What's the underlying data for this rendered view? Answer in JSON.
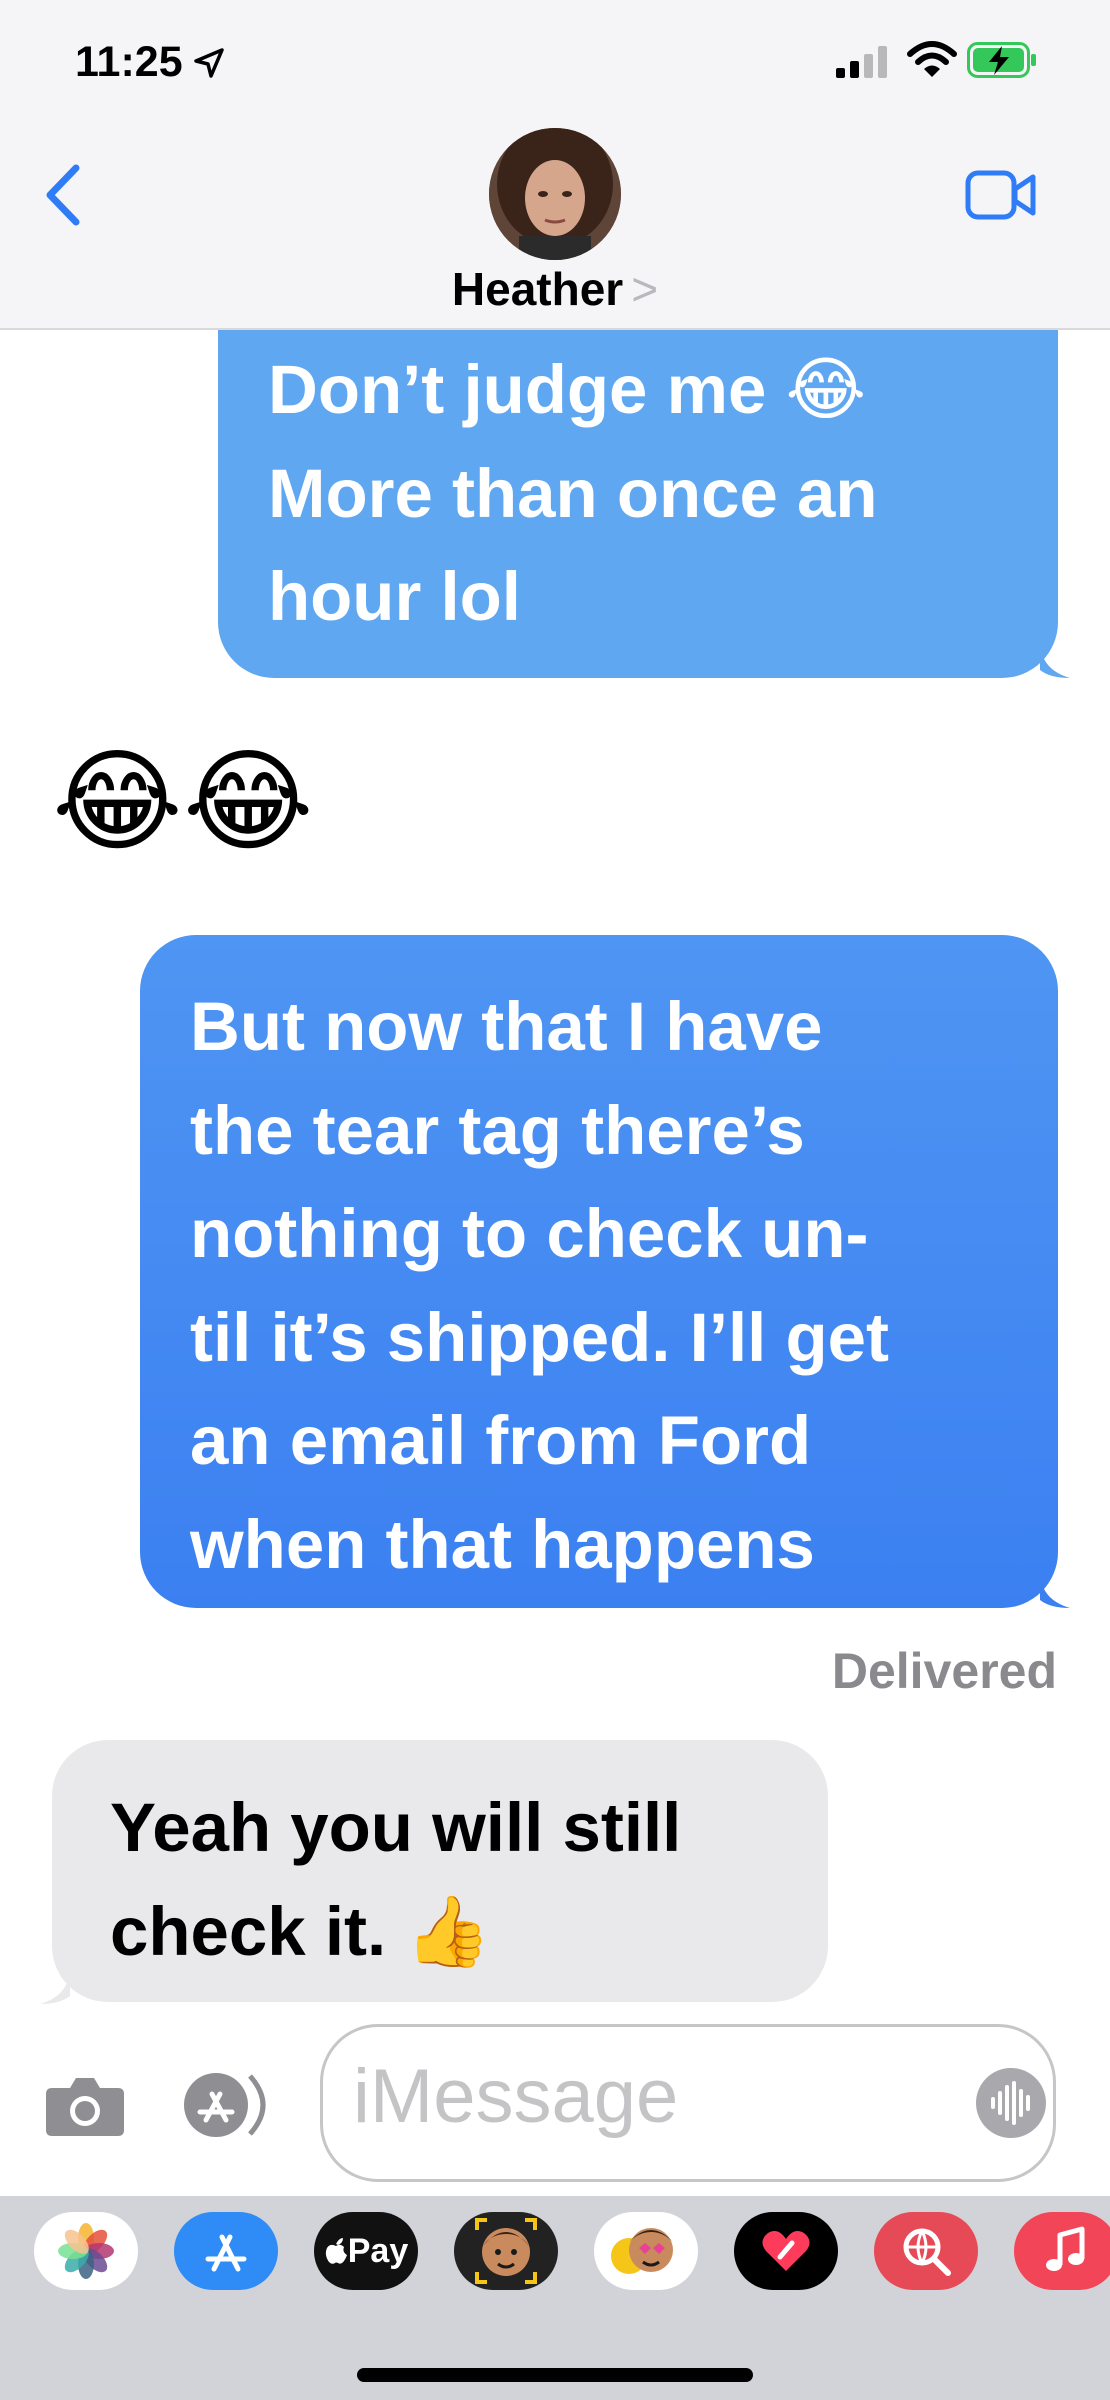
{
  "status_bar": {
    "time": "11:25",
    "icons": [
      "location-arrow-icon",
      "cellular-signal-icon",
      "wifi-icon",
      "battery-charging-icon"
    ]
  },
  "header": {
    "contact_name": "Heather",
    "chevron": ">",
    "icons": [
      "back-chevron-icon",
      "contact-avatar",
      "video-call-icon"
    ]
  },
  "messages": [
    {
      "sender": "me",
      "lines": [
        "Don’t judge me 😂",
        "More than once an",
        "hour lol"
      ]
    },
    {
      "sender": "them",
      "text": "😂😂"
    },
    {
      "sender": "me",
      "lines": [
        "But now that I have",
        "the tear tag there’s",
        "nothing to check un-",
        "til it’s shipped. I’ll get",
        "an email from Ford",
        "when that happens"
      ]
    },
    {
      "sender": "them",
      "lines": [
        "Yeah you will still",
        "check it. 👍"
      ]
    }
  ],
  "delivered_label": "Delivered",
  "compose": {
    "placeholder": "iMessage",
    "icons": [
      "camera-icon",
      "app-store-icon",
      "audio-waveform-icon"
    ]
  },
  "app_drawer": {
    "apps": [
      {
        "name": "photos-app-icon",
        "bg": "#ffffff"
      },
      {
        "name": "app-store-app-icon",
        "bg": "#2f8cf6"
      },
      {
        "name": "apple-pay-app-icon",
        "bg": "#111111",
        "label": "Pay"
      },
      {
        "name": "memoji-app-icon",
        "bg": "#222222"
      },
      {
        "name": "memoji-stickers-app-icon",
        "bg": "#ffffff"
      },
      {
        "name": "digital-touch-app-icon",
        "bg": "#000000"
      },
      {
        "name": "images-search-app-icon",
        "bg": "#e74a57"
      },
      {
        "name": "music-app-icon",
        "bg": "#f34558"
      }
    ]
  },
  "colors": {
    "sent_bubble": "#4a8ff3",
    "received_bubble": "#e9e9eb",
    "ios_blue": "#2f7cf6",
    "battery_green": "#34c759"
  }
}
